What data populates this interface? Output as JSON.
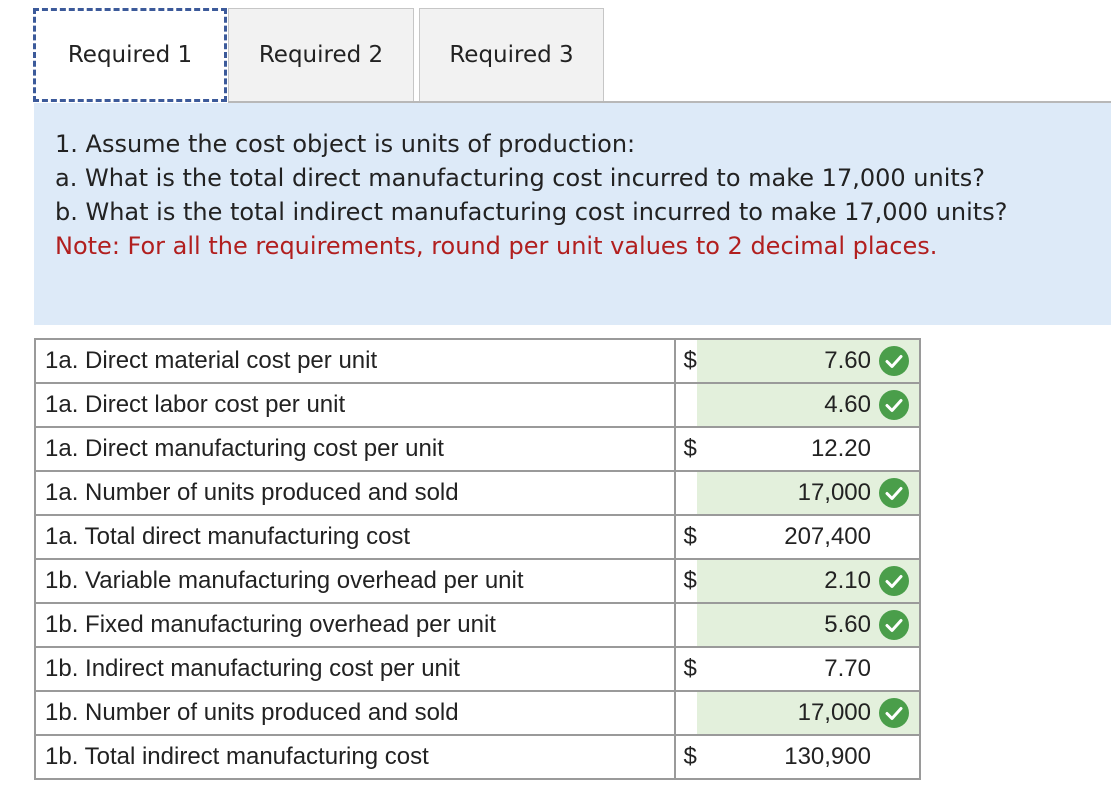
{
  "tabs": [
    {
      "label": "Required 1",
      "active": true
    },
    {
      "label": "Required 2",
      "active": false
    },
    {
      "label": "Required 3",
      "active": false
    }
  ],
  "instructions": {
    "line1": "1. Assume the cost object is units of production:",
    "line2": "a. What is the total direct manufacturing cost incurred to make 17,000 units?",
    "line3": "b. What is the total indirect manufacturing cost incurred to make 17,000 units?",
    "note": "Note: For all the requirements, round per unit values to 2 decimal places."
  },
  "colors": {
    "check_green": "#4a9e4a",
    "input_fill": "#e3f0dc",
    "note_red": "#b11f1f"
  },
  "rows": [
    {
      "label": "1a. Direct material cost per unit",
      "currency": "$",
      "value": "7.60",
      "input": true,
      "check": true
    },
    {
      "label": "1a. Direct labor cost per unit",
      "currency": "",
      "value": "4.60",
      "input": true,
      "check": true
    },
    {
      "label": "1a. Direct manufacturing cost per unit",
      "currency": "$",
      "value": "12.20",
      "input": false,
      "check": false
    },
    {
      "label": "1a. Number of units produced and sold",
      "currency": "",
      "value": "17,000",
      "input": true,
      "check": true
    },
    {
      "label": "1a. Total direct manufacturing cost",
      "currency": "$",
      "value": "207,400",
      "input": false,
      "check": false
    },
    {
      "label": "1b. Variable manufacturing overhead per unit",
      "currency": "$",
      "value": "2.10",
      "input": true,
      "check": true
    },
    {
      "label": "1b. Fixed manufacturing overhead per unit",
      "currency": "",
      "value": "5.60",
      "input": true,
      "check": true
    },
    {
      "label": "1b. Indirect manufacturing cost per unit",
      "currency": "$",
      "value": "7.70",
      "input": false,
      "check": false
    },
    {
      "label": "1b. Number of units produced and sold",
      "currency": "",
      "value": "17,000",
      "input": true,
      "check": true
    },
    {
      "label": "1b. Total indirect manufacturing cost",
      "currency": "$",
      "value": "130,900",
      "input": false,
      "check": false
    }
  ]
}
